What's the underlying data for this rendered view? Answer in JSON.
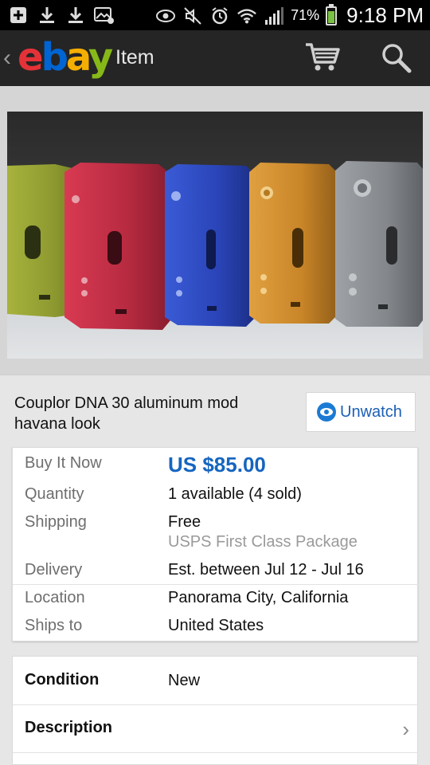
{
  "status_bar": {
    "icons": [
      "add-box-icon",
      "download-icon",
      "download-icon",
      "image-notification-icon",
      "eye-icon",
      "mute-icon",
      "alarm-icon",
      "wifi-icon",
      "signal-icon"
    ],
    "battery_percent": "71%",
    "battery_level": 0.71,
    "time": "9:18 PM"
  },
  "app_bar": {
    "logo": "ebay",
    "title": "Item",
    "back_icon": "chevron-left-icon",
    "cart_icon": "cart-icon",
    "search_icon": "search-icon"
  },
  "item": {
    "title": "Couplor DNA 30 aluminum mod havana look",
    "watch_button": "Unwatch"
  },
  "details": {
    "buy_label": "Buy It Now",
    "price": "US $85.00",
    "quantity_label": "Quantity",
    "quantity_value": "1 available (4 sold)",
    "shipping_label": "Shipping",
    "shipping_value": "Free",
    "shipping_service": "USPS First Class Package",
    "delivery_label": "Delivery",
    "delivery_value": "Est. between Jul 12 - Jul 16",
    "location_label": "Location",
    "location_value": "Panorama City, California",
    "ships_to_label": "Ships to",
    "ships_to_value": "United States"
  },
  "sections": {
    "condition_label": "Condition",
    "condition_value": "New",
    "description_label": "Description"
  },
  "colors": {
    "accent_blue": "#1565c0",
    "app_bar": "#252525",
    "ebay_red": "#e53238",
    "ebay_blue": "#0064d2",
    "ebay_yellow": "#f5af02",
    "ebay_green": "#86b817"
  }
}
